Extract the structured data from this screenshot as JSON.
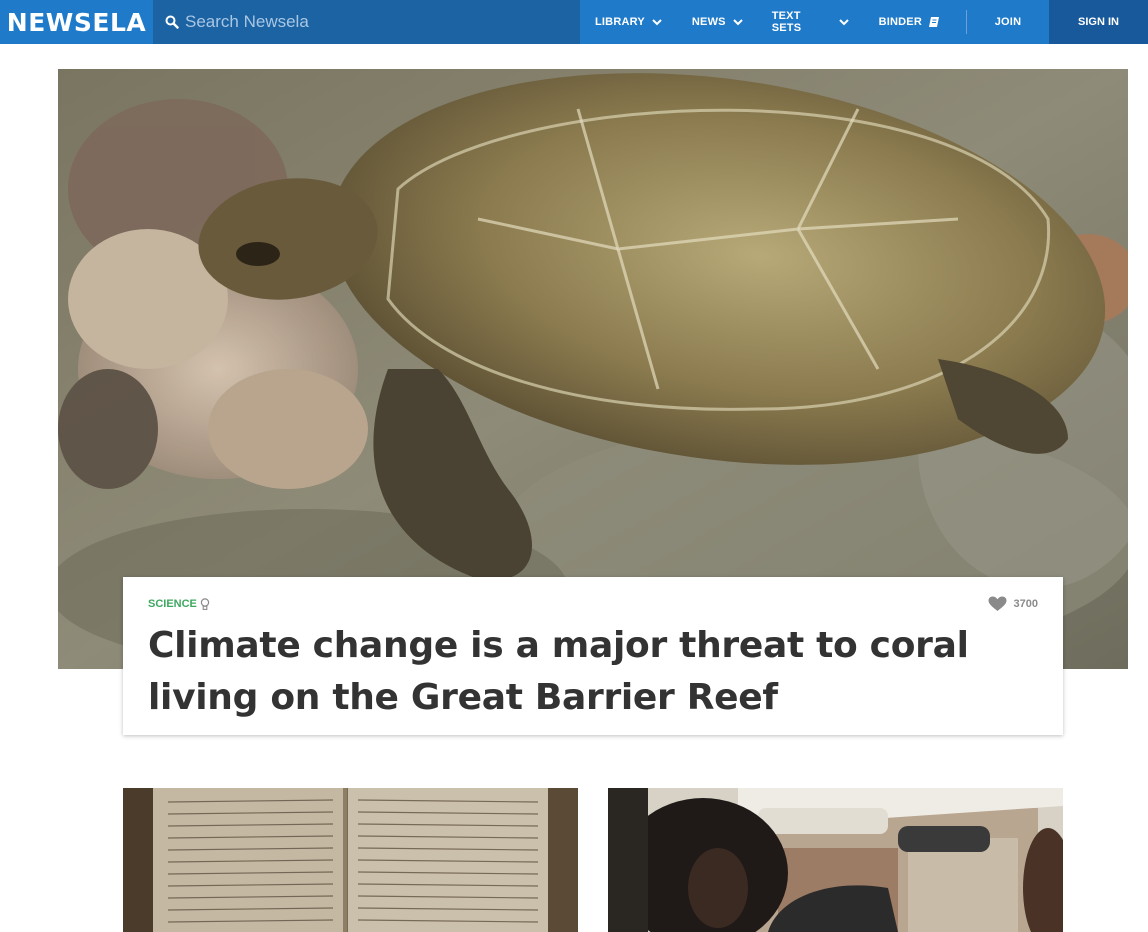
{
  "nav": {
    "logo": "NEWSELA",
    "search_placeholder": "Search Newsela",
    "items": [
      {
        "label": "LIBRARY"
      },
      {
        "label": "NEWS"
      },
      {
        "label": "TEXT SETS"
      },
      {
        "label": "BINDER"
      }
    ],
    "join": "JOIN",
    "sign_in": "SIGN IN",
    "colors": {
      "bar": "#1f7bc9",
      "search_bg": "#1b63a3",
      "sign_in_bg": "#17599a"
    }
  },
  "hero": {
    "image": "sea-turtle-on-coral-reef",
    "category": "SCIENCE",
    "category_icon": "lightbulb-icon",
    "likes": "3700",
    "likes_icon": "heart-icon",
    "title": "Climate change is a major threat to coral living on the Great Barrier Reef",
    "colors": {
      "category": "#3ea860",
      "title": "#333333"
    }
  },
  "articles": [
    {
      "image": "old-handwritten-book-pages"
    },
    {
      "image": "person-driving-car"
    }
  ]
}
